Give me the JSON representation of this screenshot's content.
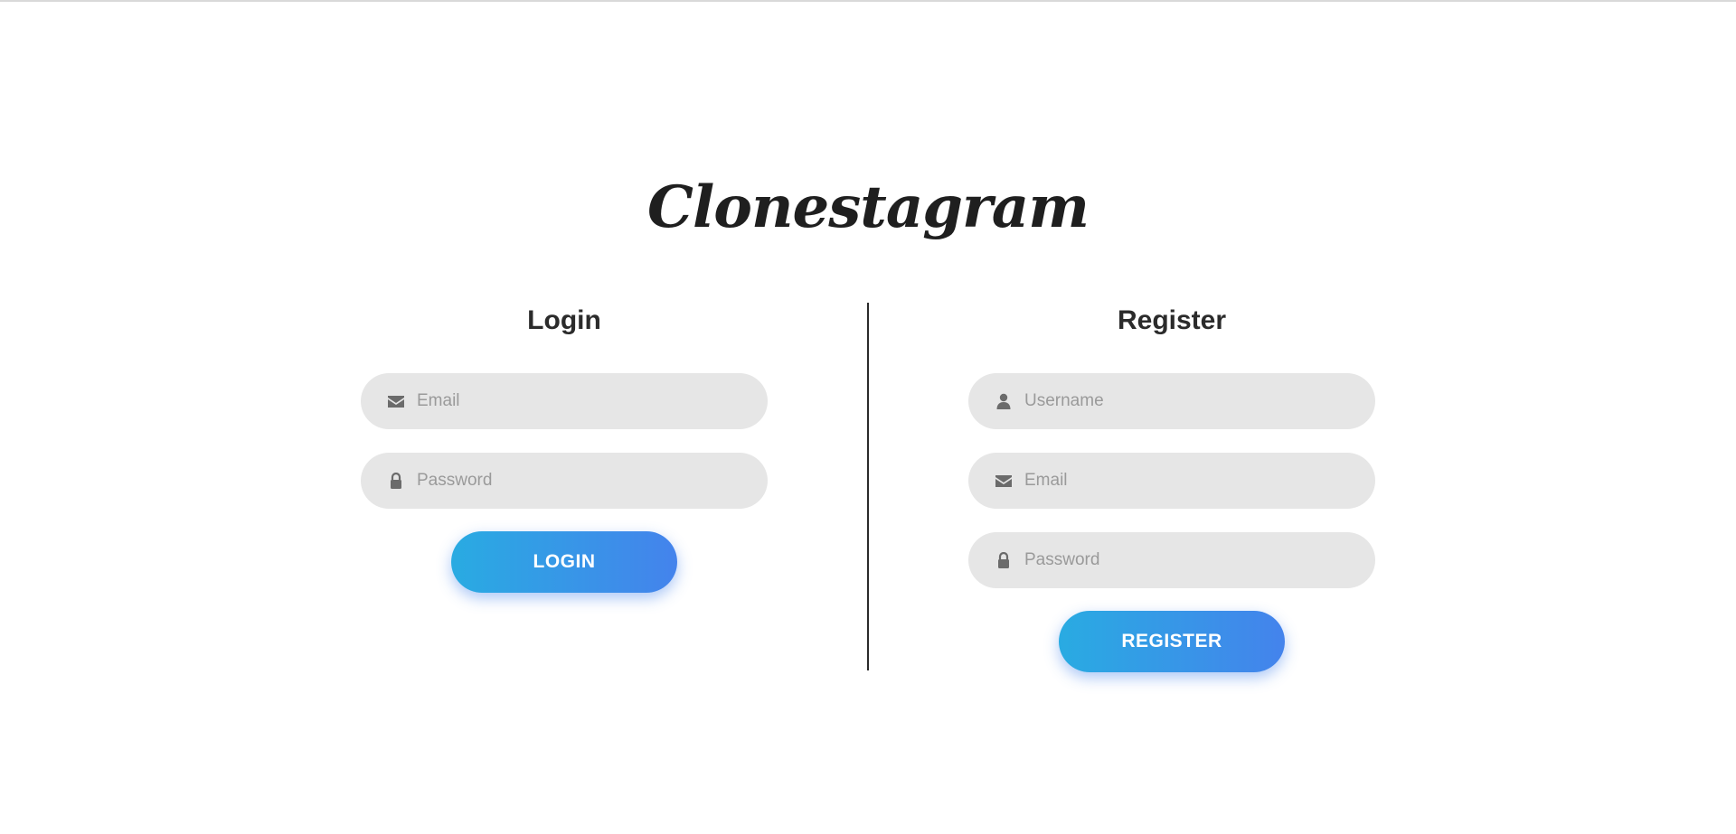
{
  "app": {
    "logo_text": "Clonestagram"
  },
  "colors": {
    "accent_start": "#29abe2",
    "accent_end": "#4483ec",
    "field_bg": "#e6e6e6"
  },
  "login": {
    "title": "Login",
    "email_placeholder": "Email",
    "email_icon": "envelope-icon",
    "password_placeholder": "Password",
    "password_icon": "lock-icon",
    "button_label": "LOGIN"
  },
  "register": {
    "title": "Register",
    "username_placeholder": "Username",
    "username_icon": "user-icon",
    "email_placeholder": "Email",
    "email_icon": "envelope-icon",
    "password_placeholder": "Password",
    "password_icon": "lock-icon",
    "button_label": "REGISTER"
  }
}
